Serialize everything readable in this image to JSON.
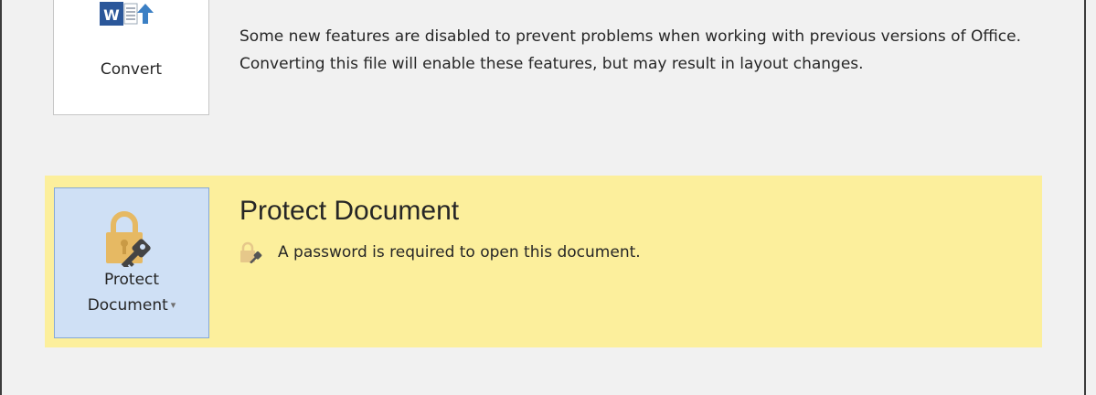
{
  "convert": {
    "label": "Convert",
    "description": "Some new features are disabled to prevent problems when working with previous versions of Office. Converting this file will enable these features, but may result in layout changes.",
    "icon": "word-convert-icon",
    "icon_letter": "W"
  },
  "protect": {
    "title": "Protect Document",
    "button_label_line1": "Protect",
    "button_label_line2": "Document",
    "dropdown_caret": "▾",
    "info": "A password is required to open this document.",
    "icon": "lock-key-icon",
    "panel_color": "#fcef9c",
    "button_color": "#cfe0f5"
  },
  "colors": {
    "lock_gold": "#e6b963",
    "key_dark": "#444444",
    "word_blue": "#2b579a",
    "arrow_blue": "#3b7fc4"
  }
}
